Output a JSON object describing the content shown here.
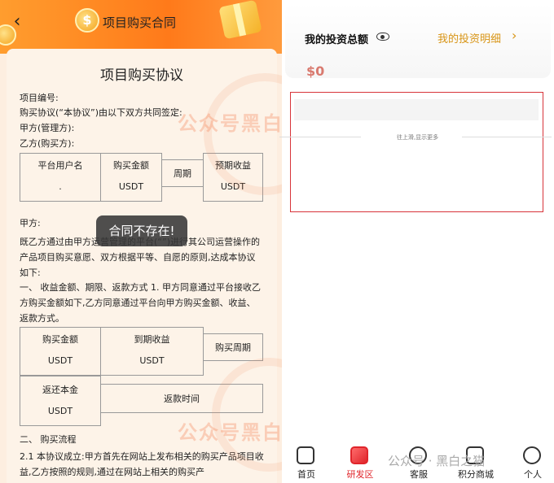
{
  "header": {
    "title": "项目购买合同"
  },
  "doc": {
    "title": "项目购买协议",
    "project_no": "项目编号:",
    "intro": "购买协议(“本协议”)由以下双方共同签定:",
    "party_a": "甲方(管理方):",
    "party_b": "乙方(购买方):",
    "table1": {
      "h1": "平台用户名",
      "h2": "购买金额",
      "h3": "周期",
      "h4": "预期收益",
      "v1": ".",
      "v2": "USDT",
      "v4": "USDT"
    },
    "party_a_label": "甲方:",
    "para1": "既乙方通过由甲方运营管理的平台(“”)进行其公司运营操作的产品项目购买意愿、双方根据平等、自愿的原则,达成本协议如下:",
    "para2": "一、 收益金额、期限、返款方式 1. 甲方同意通过平台接收乙方购买金额如下,乙方同意通过平台向甲方购买金额、收益、返款方式。",
    "table2": {
      "h1": "购买金额",
      "h2": "到期收益",
      "h3": "购买周期",
      "v1": "USDT",
      "v2": "USDT",
      "h4": "返还本金",
      "h5": "返款时间",
      "v4": "USDT"
    },
    "section2": "二、 购买流程",
    "para3": "2.1 本协议成立:甲方首先在网站上发布相关的购买产品项目收益,乙方按照的规则,通过在网站上相关的购买产"
  },
  "toast": "合同不存在!",
  "watermark": "公众号黑白之猫",
  "right": {
    "invest_title": "我的投资总额",
    "detail_link": "我的投资明细",
    "total_value": "$0",
    "pull_hint": "往上滑,显示更多"
  },
  "bottom_watermark": "公众号 · 黑白之猫",
  "nav": [
    {
      "label": "首页",
      "icon": "home-icon"
    },
    {
      "label": "研发区",
      "icon": "chart-icon"
    },
    {
      "label": "客服",
      "icon": "headset-icon"
    },
    {
      "label": "积分商城",
      "icon": "store-icon"
    },
    {
      "label": "个人",
      "icon": "user-icon"
    }
  ],
  "colors": {
    "accent_orange": "#ff7a1a",
    "gold": "#d89516",
    "active_red": "#e0252b"
  }
}
